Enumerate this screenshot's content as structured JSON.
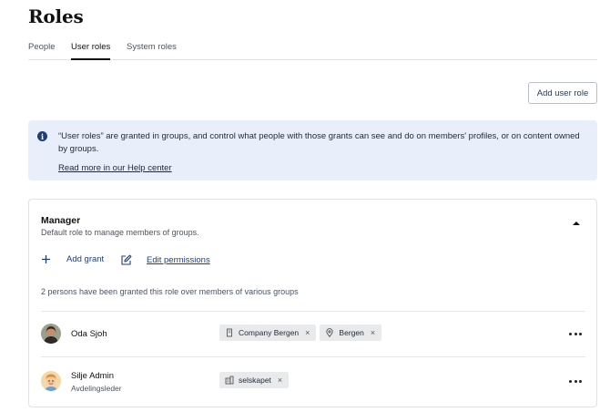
{
  "page": {
    "title": "Roles"
  },
  "tabs": [
    {
      "label": "People",
      "active": false
    },
    {
      "label": "User roles",
      "active": true
    },
    {
      "label": "System roles",
      "active": false
    }
  ],
  "add_user_role_label": "Add user role",
  "info": {
    "icon": "info-icon",
    "text": "“User roles” are granted in groups, and control what people with those grants can see and do on members' profiles, or on content owned by groups.",
    "link": "Read more in our Help center"
  },
  "role": {
    "name": "Manager",
    "description": "Default role to manage members of groups.",
    "actions": {
      "add_grant": "Add grant",
      "edit_permissions": "Edit permissions"
    },
    "summary": "2 persons have been granted this role over members of various groups",
    "people": [
      {
        "name": "Oda Sjoh",
        "subtitle": "",
        "grants": [
          {
            "label": "Company Bergen",
            "icon": "building-icon"
          },
          {
            "label": "Bergen",
            "icon": "location-pin-icon"
          }
        ]
      },
      {
        "name": "Silje Admin",
        "subtitle": "Avdelingsleder",
        "grants": [
          {
            "label": "selskapet",
            "icon": "organization-icon"
          }
        ]
      }
    ]
  },
  "colors": {
    "accent": "#1f3f7a",
    "info_bg": "#e8effb",
    "chip_bg": "#e9eaec"
  }
}
